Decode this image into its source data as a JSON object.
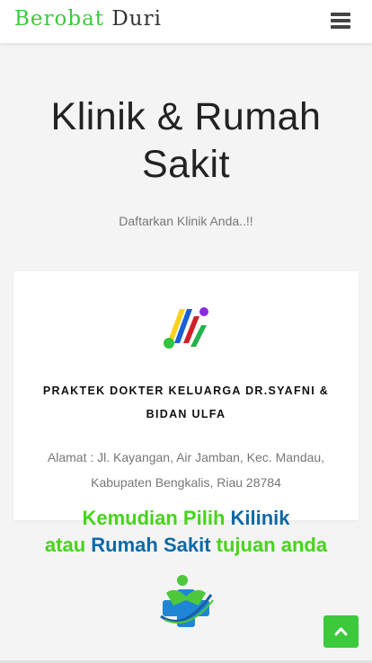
{
  "header": {
    "brand_part1": "Berobat",
    "brand_part2": "Duri",
    "menu_icon": "hamburger-icon"
  },
  "hero": {
    "title_line1": "Klinik & Rumah",
    "title_line2": "Sakit",
    "subtitle": "Daftarkan Klinik Anda..!!"
  },
  "card": {
    "name_line1": "PRAKTEK DOKTER KELUARGA DR.SYAFNI &",
    "name_line2": "BIDAN ULFA",
    "address_line1": "Alamat : Jl. Kayangan, Air Jamban, Kec. Mandau,",
    "address_line2": "Kabupaten Bengkalis, Riau 28784"
  },
  "promo": {
    "line1_a": "Kemudian Pilih",
    "line1_b": "Kilinik",
    "line2_a": "atau",
    "line2_b": "Rumah Sakit",
    "line2_c": "tujuan anda"
  },
  "scroll_top": {
    "icon": "chevron-up-icon"
  },
  "colors": {
    "brand_green": "#3cc93c",
    "promo_green": "#46d41a",
    "promo_blue": "#0d69a6"
  }
}
